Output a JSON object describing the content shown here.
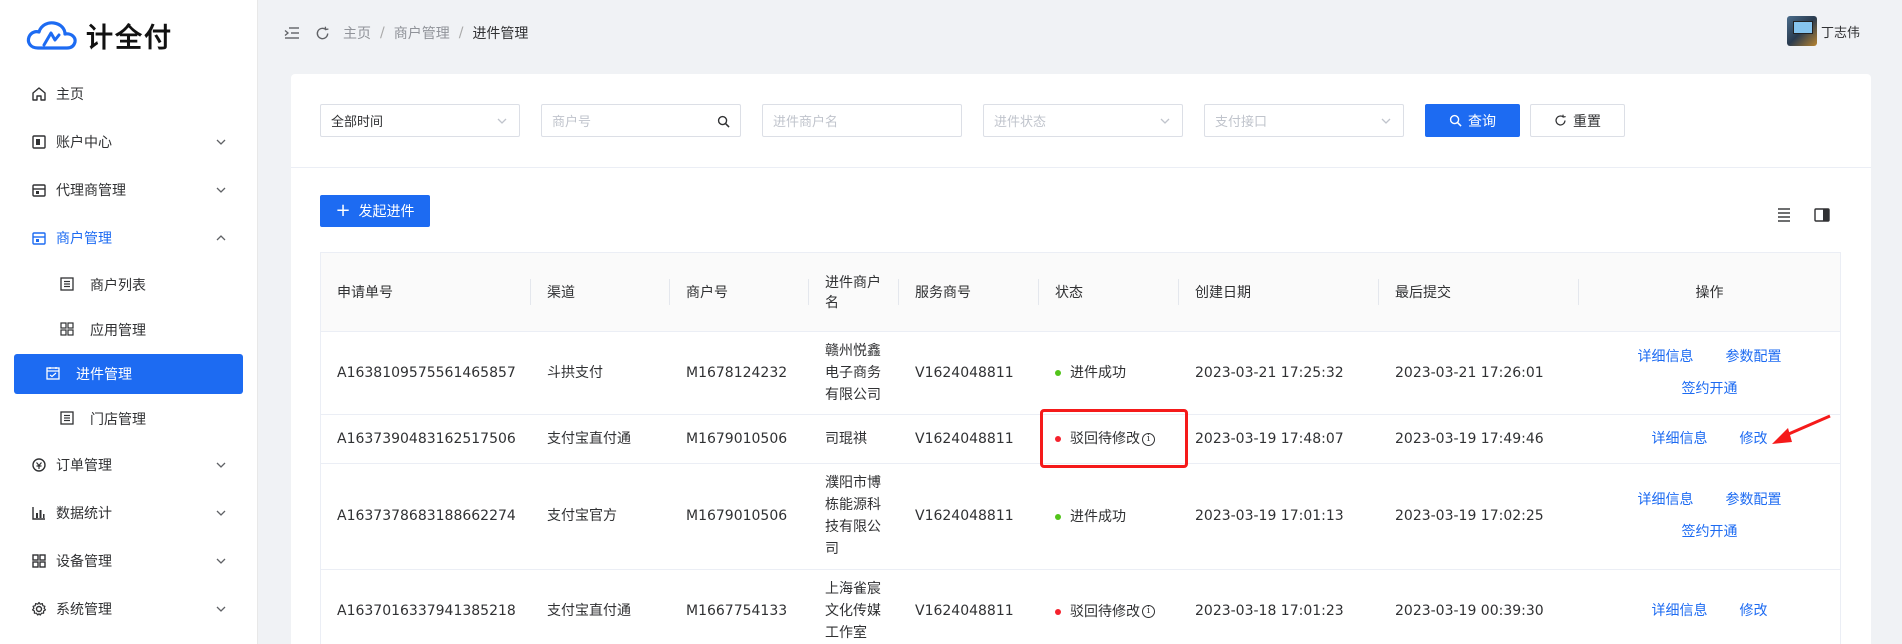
{
  "app": {
    "logo_text": "计全付"
  },
  "sidebar": {
    "items": [
      {
        "label": "主页",
        "icon": "home-icon",
        "has_arrow": false
      },
      {
        "label": "账户中心",
        "icon": "account-icon",
        "has_arrow": true
      },
      {
        "label": "代理商管理",
        "icon": "agent-icon",
        "has_arrow": true
      },
      {
        "label": "商户管理",
        "icon": "store-icon",
        "has_arrow": true,
        "open": true,
        "children": [
          {
            "label": "商户列表",
            "icon": "list-icon"
          },
          {
            "label": "应用管理",
            "icon": "apps-grid-icon"
          },
          {
            "label": "进件管理",
            "icon": "calendar-icon",
            "active": true
          },
          {
            "label": "门店管理",
            "icon": "list-icon"
          }
        ]
      },
      {
        "label": "订单管理",
        "icon": "order-icon",
        "has_arrow": true
      },
      {
        "label": "数据统计",
        "icon": "chart-icon",
        "has_arrow": true
      },
      {
        "label": "设备管理",
        "icon": "device-grid-icon",
        "has_arrow": true
      },
      {
        "label": "系统管理",
        "icon": "gear-icon",
        "has_arrow": true
      }
    ]
  },
  "header": {
    "breadcrumb": [
      "主页",
      "商户管理",
      "进件管理"
    ],
    "user_name": "丁志伟"
  },
  "filters": {
    "time": {
      "value": "全部时间"
    },
    "merchant_no": {
      "placeholder": "商户号"
    },
    "merchant_name": {
      "placeholder": "进件商户名"
    },
    "status": {
      "placeholder": "进件状态"
    },
    "pay_interface": {
      "placeholder": "支付接口"
    },
    "query_label": "查询",
    "reset_label": "重置"
  },
  "toolbar": {
    "add_label": "发起进件"
  },
  "table": {
    "headers": [
      "申请单号",
      "渠道",
      "商户号",
      "进件商户名",
      "服务商号",
      "状态",
      "创建日期",
      "最后提交",
      "操作"
    ],
    "rows": [
      {
        "id": "A1638109575561465857",
        "channel": "斗拱支付",
        "merchant_no": "M1678124232",
        "merchant_name": "赣州悦鑫电子商务有限公司",
        "provider_no": "V1624048811",
        "status": "进件成功",
        "status_color": "#52c41a",
        "status_info": false,
        "created": "2023-03-21 17:25:32",
        "last_submit": "2023-03-21 17:26:01",
        "ops": [
          [
            "详细信息",
            "参数配置"
          ],
          [
            "签约开通"
          ]
        ]
      },
      {
        "id": "A1637390483162517506",
        "channel": "支付宝直付通",
        "merchant_no": "M1679010506",
        "merchant_name": "司琨祺",
        "provider_no": "V1624048811",
        "status": "驳回待修改",
        "status_color": "#f5222d",
        "status_info": true,
        "created": "2023-03-19 17:48:07",
        "last_submit": "2023-03-19 17:49:46",
        "ops": [
          [
            "详细信息",
            "修改"
          ]
        ]
      },
      {
        "id": "A1637378683188662274",
        "channel": "支付宝官方",
        "merchant_no": "M1679010506",
        "merchant_name": "濮阳市博栋能源科技有限公司",
        "provider_no": "V1624048811",
        "status": "进件成功",
        "status_color": "#52c41a",
        "status_info": false,
        "created": "2023-03-19 17:01:13",
        "last_submit": "2023-03-19 17:02:25",
        "ops": [
          [
            "详细信息",
            "参数配置"
          ],
          [
            "签约开通"
          ]
        ]
      },
      {
        "id": "A1637016337941385218",
        "channel": "支付宝直付通",
        "merchant_no": "M1667754133",
        "merchant_name": "上海雀宸文化传媒工作室",
        "provider_no": "V1624048811",
        "status": "驳回待修改",
        "status_color": "#f5222d",
        "status_info": true,
        "created": "2023-03-18 17:01:23",
        "last_submit": "2023-03-19 00:39:30",
        "ops": [
          [
            "详细信息",
            "修改"
          ]
        ]
      }
    ]
  },
  "colors": {
    "accent": "#1d6bf2",
    "success": "#52c41a",
    "error": "#f5222d",
    "annotation": "#f51a1a"
  }
}
